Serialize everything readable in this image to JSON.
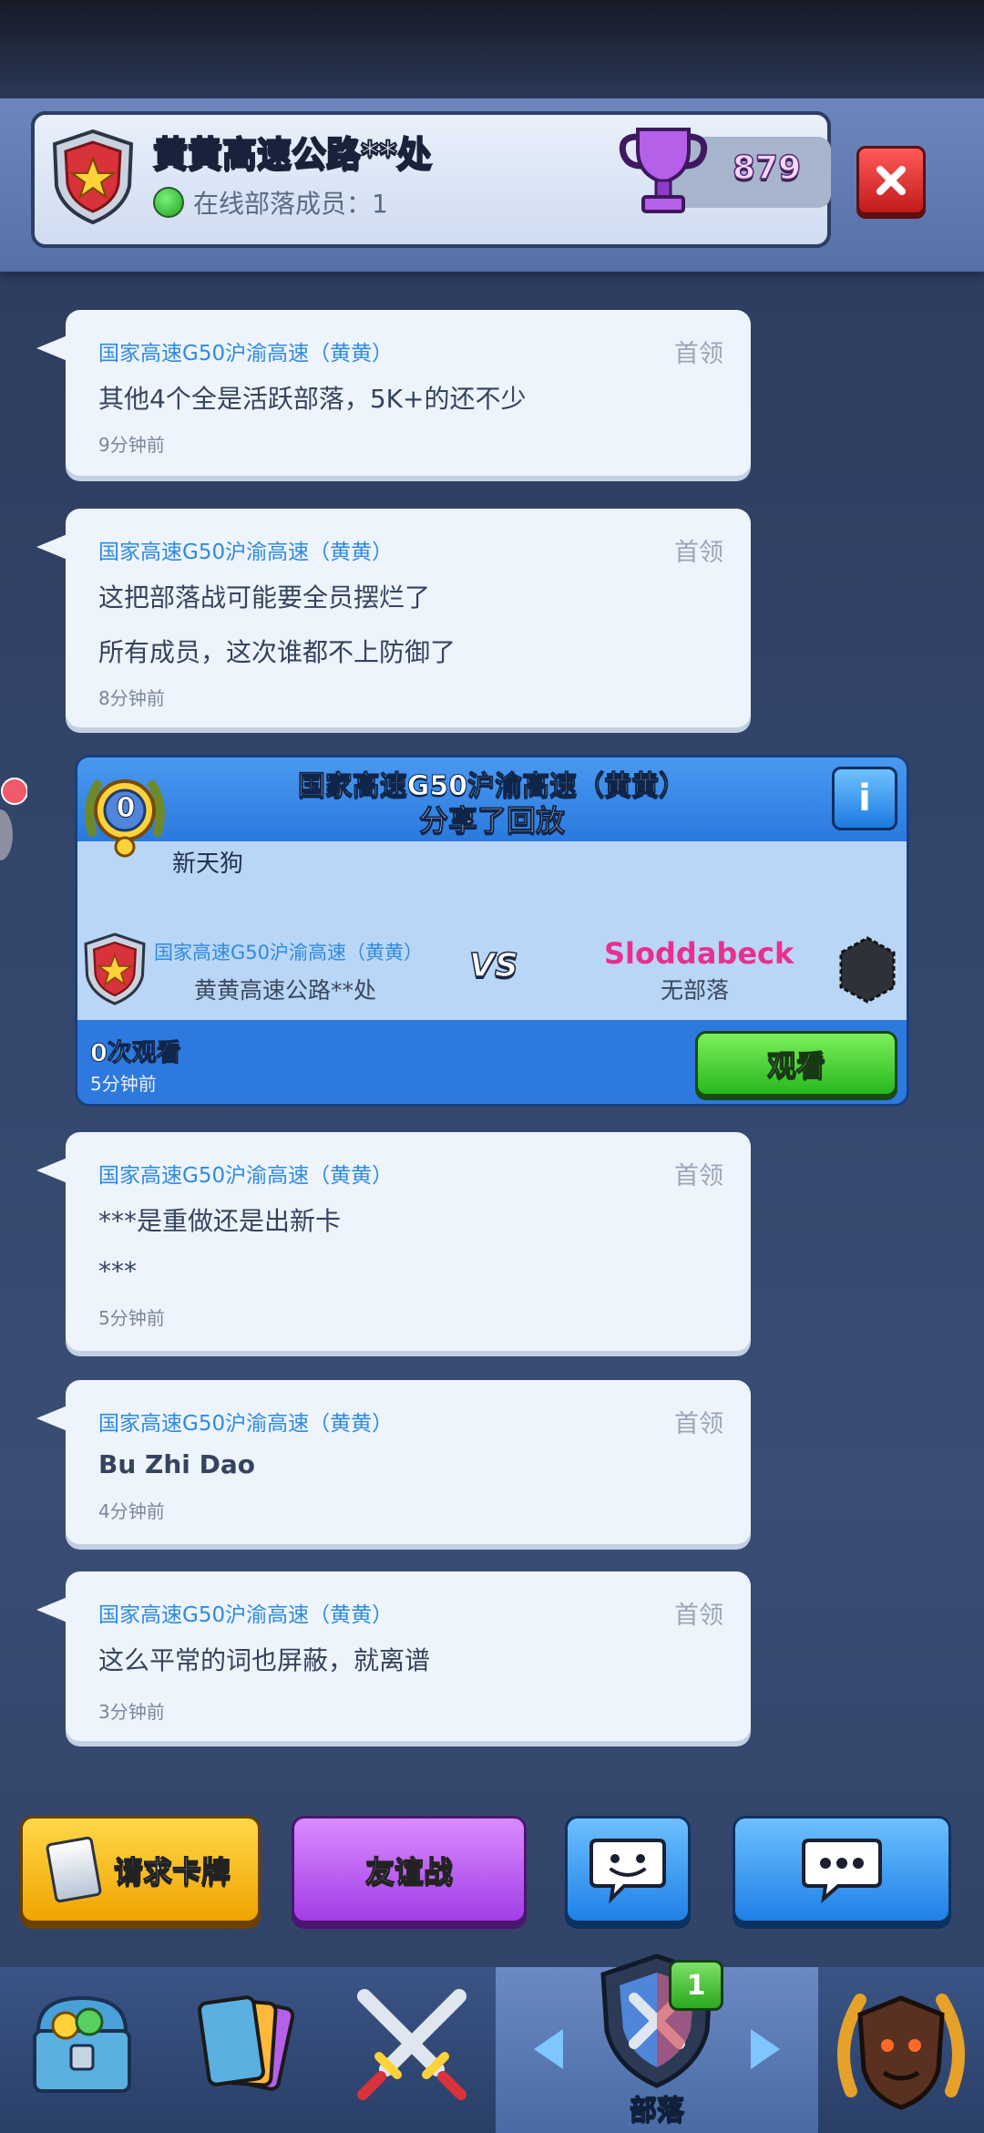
{
  "header": {
    "clan_name": "黄黄高速公路**处",
    "online_text": "在线部落成员：1",
    "trophies": "879"
  },
  "messages": [
    {
      "sender": "国家高速G50沪渝高速（黄黄）",
      "role": "首领",
      "lines": [
        "其他4个全是活跃部落，5K+的还不少"
      ],
      "time": "9分钟前"
    },
    {
      "sender": "国家高速G50沪渝高速（黄黄）",
      "role": "首领",
      "lines": [
        "这把部落战可能要全员摆烂了",
        "所有成员，这次谁都不上防御了"
      ],
      "time": "8分钟前"
    },
    {
      "sender": "国家高速G50沪渝高速（黄黄）",
      "role": "首领",
      "lines": [
        "***是重做还是出新卡",
        "***"
      ],
      "time": "5分钟前"
    },
    {
      "sender": "国家高速G50沪渝高速（黄黄）",
      "role": "首领",
      "lines": [
        "Bu Zhi Dao"
      ],
      "time": "4分钟前"
    },
    {
      "sender": "国家高速G50沪渝高速（黄黄）",
      "role": "首领",
      "lines": [
        "这么平常的词也屏蔽，就离谱"
      ],
      "time": "3分钟前"
    }
  ],
  "replay": {
    "title_line1": "国家高速G50沪渝高速（黄黄）",
    "title_line2": "分享了回放",
    "level": "0",
    "player_name": "新天狗",
    "left_sender": "国家高速G50沪渝高速（黄黄）",
    "left_clan": "黄黄高速公路**处",
    "vs": "VS",
    "opponent_name": "Sloddabeck",
    "opponent_clan": "无部落",
    "views": "0次观看",
    "time": "5分钟前",
    "watch_label": "观看",
    "info_label": "i"
  },
  "actions": {
    "request_cards": "请求卡牌",
    "friendly_battle": "友谊战"
  },
  "nav": {
    "clan_label": "部落",
    "clan_badge_count": "1"
  },
  "colors": {
    "accent_blue": "#2f8ae0",
    "opponent_pink": "#ea2f8f",
    "watch_green": "#27b81e"
  }
}
